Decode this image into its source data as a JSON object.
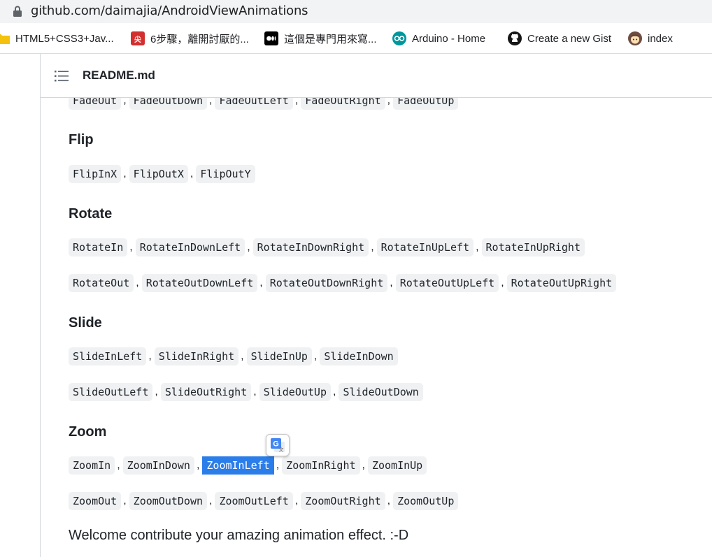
{
  "browser": {
    "url": "github.com/daimajia/AndroidViewAnimations"
  },
  "bookmarks": [
    {
      "label": "HTML5+CSS3+Jav...",
      "icon": "folder-icon",
      "color": "#f4c20d"
    },
    {
      "label": "6步驟，離開討厭的...",
      "icon": "site-favicon-red",
      "color": "#d32f2f"
    },
    {
      "label": "這個是專門用來寫...",
      "icon": "medium-icon",
      "color": "#000000"
    },
    {
      "label": "Arduino - Home",
      "icon": "arduino-icon",
      "color": "#00979c"
    },
    {
      "label": "Create a new Gist",
      "icon": "github-icon",
      "color": "#181717"
    },
    {
      "label": "index",
      "icon": "avatar-icon",
      "color": "#8d6e63"
    }
  ],
  "readme": {
    "title": "README.md"
  },
  "sections": {
    "fade_row": [
      "FadeOut",
      "FadeOutDown",
      "FadeOutLeft",
      "FadeOutRight",
      "FadeOutUp"
    ],
    "flip": {
      "heading": "Flip",
      "rows": [
        [
          "FlipInX",
          "FlipOutX",
          "FlipOutY"
        ]
      ]
    },
    "rotate": {
      "heading": "Rotate",
      "rows": [
        [
          "RotateIn",
          "RotateInDownLeft",
          "RotateInDownRight",
          "RotateInUpLeft",
          "RotateInUpRight"
        ],
        [
          "RotateOut",
          "RotateOutDownLeft",
          "RotateOutDownRight",
          "RotateOutUpLeft",
          "RotateOutUpRight"
        ]
      ]
    },
    "slide": {
      "heading": "Slide",
      "rows": [
        [
          "SlideInLeft",
          "SlideInRight",
          "SlideInUp",
          "SlideInDown"
        ],
        [
          "SlideOutLeft",
          "SlideOutRight",
          "SlideOutUp",
          "SlideOutDown"
        ]
      ]
    },
    "zoom": {
      "heading": "Zoom",
      "rows": [
        [
          "ZoomIn",
          "ZoomInDown",
          "ZoomInLeft",
          "ZoomInRight",
          "ZoomInUp"
        ],
        [
          "ZoomOut",
          "ZoomOutDown",
          "ZoomOutLeft",
          "ZoomOutRight",
          "ZoomOutUp"
        ]
      ]
    },
    "selected_item": "ZoomInLeft"
  },
  "footer_text": "Welcome contribute your amazing animation effect. :-D",
  "colors": {
    "code_bg": "#eff1f3",
    "selection": "#2b7de9",
    "text": "#1f2328"
  }
}
